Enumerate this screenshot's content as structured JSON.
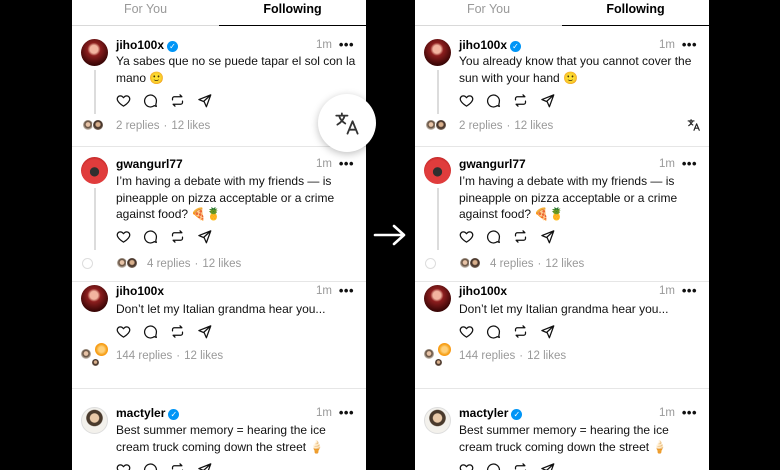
{
  "tabs": {
    "for_you": "For You",
    "following": "Following"
  },
  "posts_original": [
    {
      "username": "jiho100x",
      "verified": true,
      "time": "1m",
      "text": "Ya sabes que no se puede tapar el sol con la mano 🙂",
      "replies": "2 replies",
      "likes": "12 likes"
    },
    {
      "username": "gwangurl77",
      "verified": false,
      "time": "1m",
      "text": "I’m having a debate with my friends — is pineapple on pizza acceptable or a crime against food? 🍕🍍",
      "replies": "4 replies",
      "likes": "12 likes"
    },
    {
      "username": "jiho100x",
      "verified": false,
      "time": "1m",
      "text": "Don’t let my Italian grandma hear you...",
      "replies": "144 replies",
      "likes": "12 likes"
    },
    {
      "username": "mactyler",
      "verified": true,
      "time": "1m",
      "text": "Best summer memory = hearing the ice cream truck coming down the street 🍦"
    }
  ],
  "posts_translated": [
    {
      "username": "jiho100x",
      "verified": true,
      "time": "1m",
      "text": "You already know that you cannot cover the sun with your hand 🙂",
      "replies": "2 replies",
      "likes": "12 likes"
    },
    {
      "username": "gwangurl77",
      "verified": false,
      "time": "1m",
      "text": "I’m having a debate with my friends — is pineapple on pizza acceptable or a crime against food? 🍕🍍",
      "replies": "4 replies",
      "likes": "12 likes"
    },
    {
      "username": "jiho100x",
      "verified": false,
      "time": "1m",
      "text": "Don’t let my Italian grandma hear you...",
      "replies": "144 replies",
      "likes": "12 likes"
    },
    {
      "username": "mactyler",
      "verified": true,
      "time": "1m",
      "text": "Best summer memory = hearing the ice cream truck coming down the street 🍦"
    }
  ],
  "more_label": "•••",
  "icons": {
    "like": "heart-icon",
    "reply": "comment-icon",
    "repost": "repost-icon",
    "share": "send-icon",
    "translate": "translate-icon",
    "arrow": "right-arrow-icon",
    "verified": "verified-badge-icon"
  },
  "colors": {
    "verified": "#0095f6",
    "muted": "#999999",
    "background": "#000000"
  }
}
